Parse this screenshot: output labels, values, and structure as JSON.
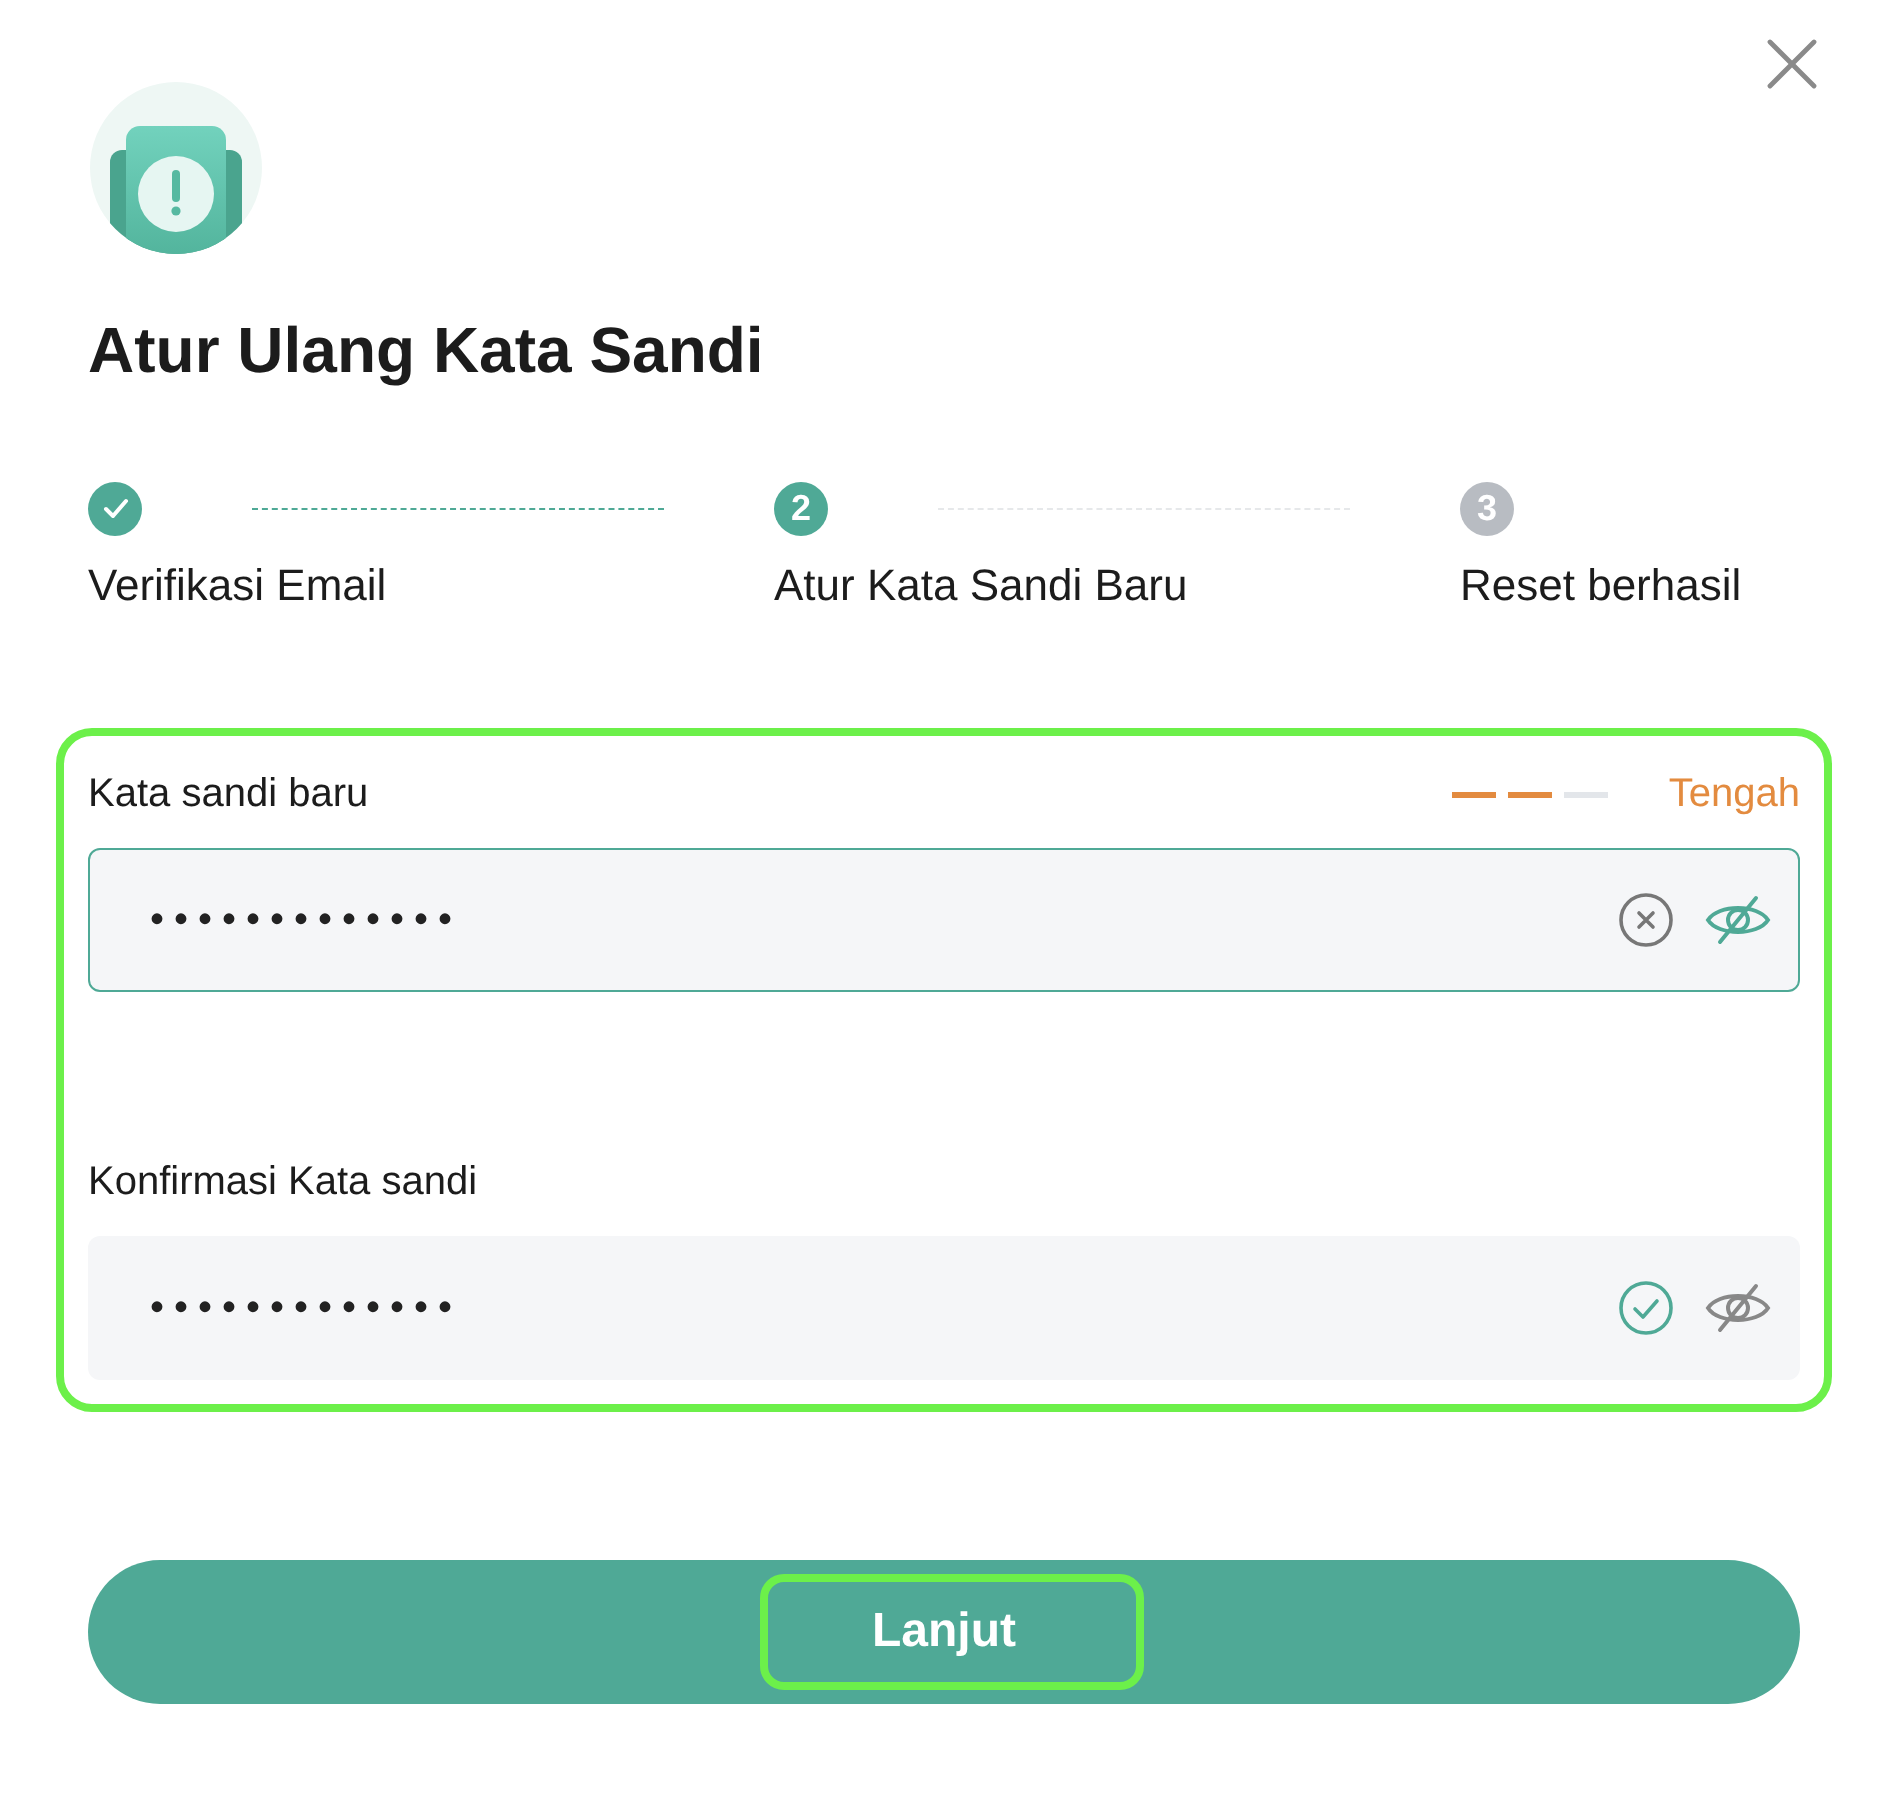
{
  "dialog": {
    "title": "Atur Ulang Kata Sandi"
  },
  "steps": [
    {
      "label": "Verifikasi Email",
      "kind": "done"
    },
    {
      "number": "2",
      "label": "Atur Kata Sandi Baru",
      "kind": "current"
    },
    {
      "number": "3",
      "label": "Reset berhasil",
      "kind": "pending"
    }
  ],
  "strength": {
    "level": 0.667,
    "label": "Tengah"
  },
  "fields": [
    {
      "label": "Kata sandi baru",
      "value": "•••••••••••••",
      "focused": true,
      "kind": "clear"
    },
    {
      "label": "Konfirmasi Kata sandi",
      "value": "•••••••••••••",
      "focused": false,
      "kind": "valid"
    }
  ],
  "button": {
    "label": "Lanjut"
  }
}
